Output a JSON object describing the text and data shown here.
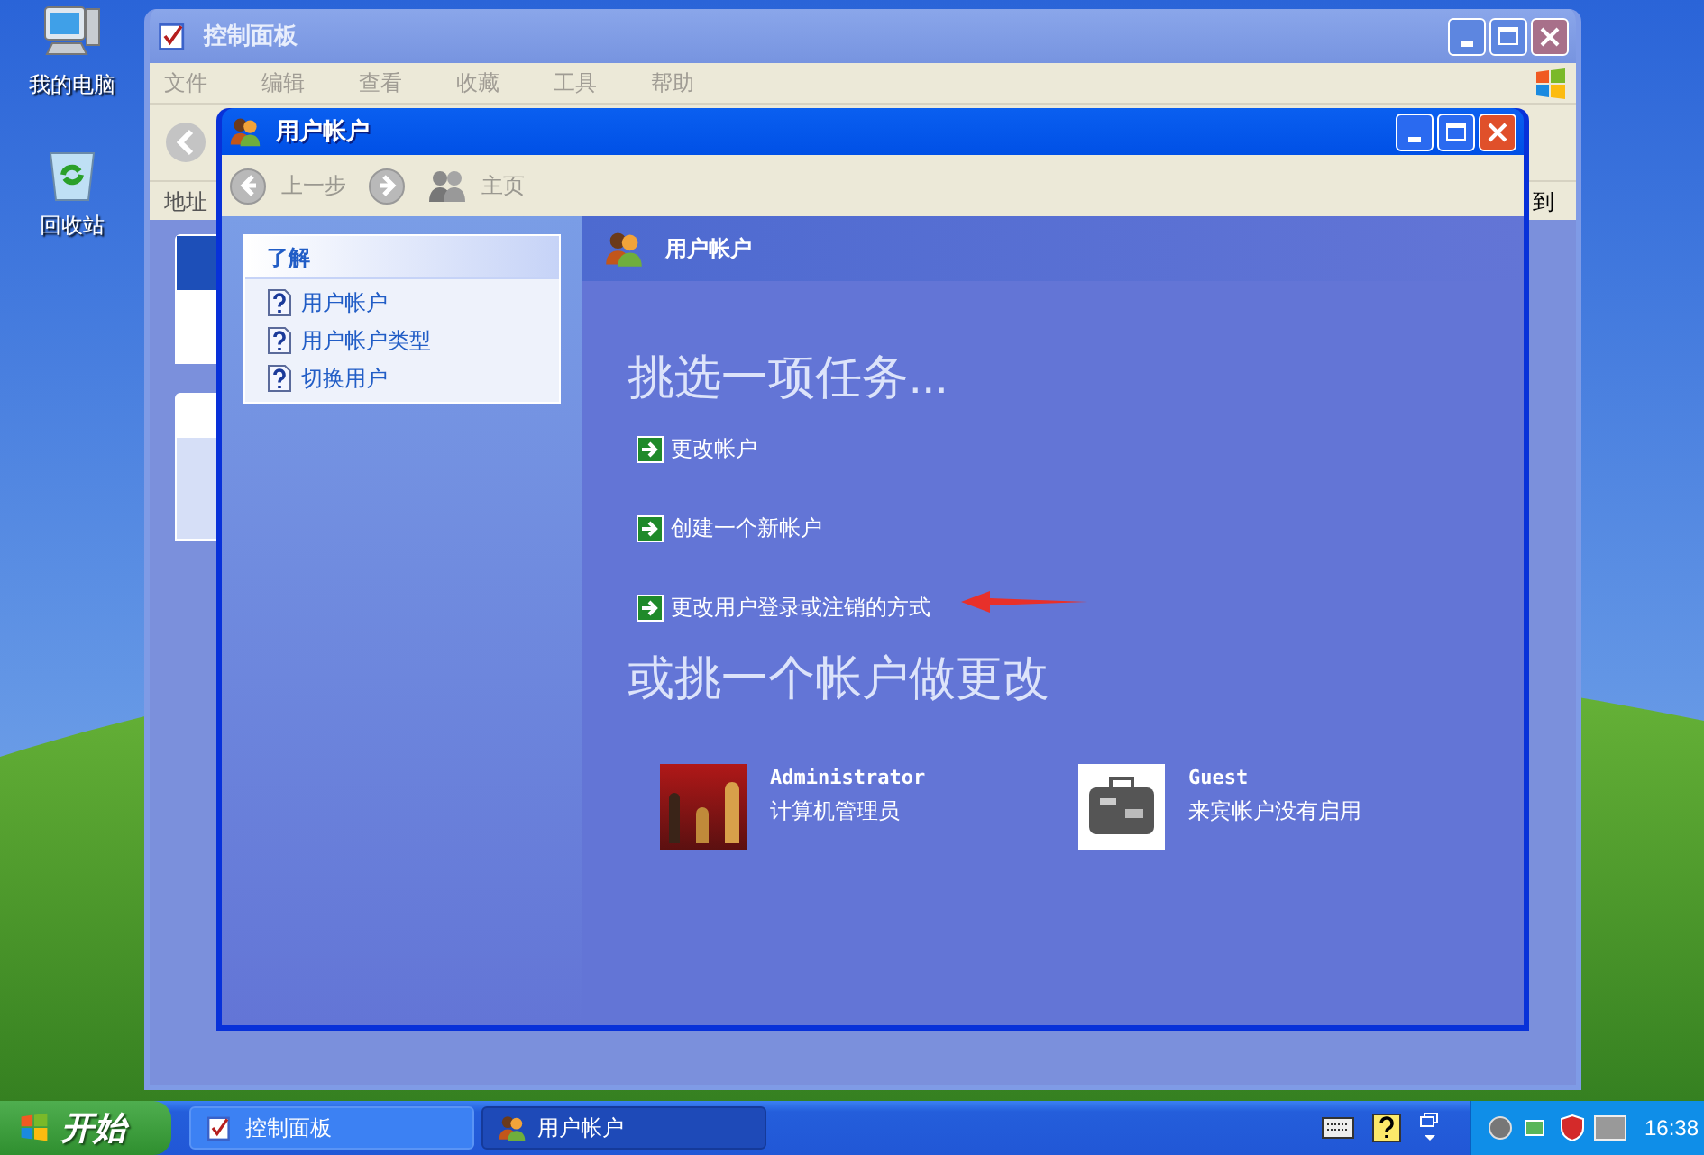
{
  "desktop_icons": [
    {
      "label": "我的电脑",
      "kind": "computer"
    },
    {
      "label": "回收站",
      "kind": "recycle"
    }
  ],
  "back_window": {
    "title": "控制面板",
    "menu": [
      "文件",
      "编辑",
      "查看",
      "收藏",
      "工具",
      "帮助"
    ],
    "address_label": "地址",
    "go_label": "到"
  },
  "window": {
    "title": "用户帐户",
    "toolbar": [
      {
        "kind": "back",
        "label": "上一步",
        "disabled": true
      },
      {
        "kind": "forward",
        "disabled": true
      },
      {
        "kind": "home",
        "label": "主页",
        "disabled": true
      }
    ],
    "sidebar": {
      "heading": "了解",
      "items": [
        "用户帐户",
        "用户帐户类型",
        "切换用户"
      ]
    },
    "header": "用户帐户",
    "task_heading": "挑选一项任务...",
    "tasks": [
      "更改帐户",
      "创建一个新帐户",
      "更改用户登录或注销的方式"
    ],
    "account_heading": "或挑一个帐户做更改",
    "accounts": [
      {
        "kind": "chess",
        "name": "Administrator",
        "description": "计算机管理员"
      },
      {
        "kind": "suitcase",
        "name": "Guest",
        "description": "来宾帐户没有启用"
      }
    ]
  },
  "taskbar": {
    "start": "开始",
    "tasks": [
      {
        "kind": "control-panel",
        "label": "控制面板",
        "selected": false
      },
      {
        "kind": "users",
        "label": "用户帐户",
        "selected": true
      }
    ],
    "clock": "16:38"
  }
}
